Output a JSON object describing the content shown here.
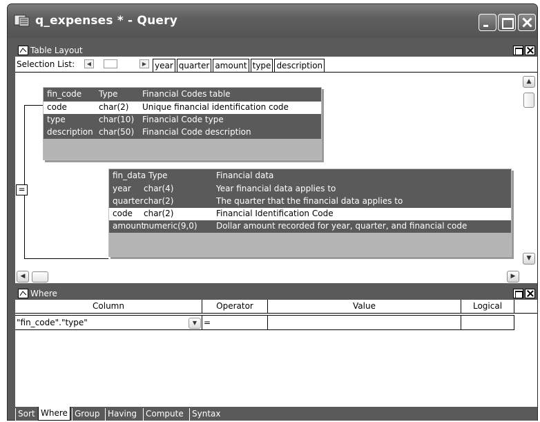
{
  "window": {
    "title": "q_expenses * - Query"
  },
  "table_layout": {
    "title": "Table Layout",
    "selection_label": "Selection List:",
    "selection_items": [
      "year",
      "quarter",
      "amount",
      "type",
      "description"
    ],
    "link_operator": "=",
    "fin_code": {
      "header": [
        "fin_code",
        "Type",
        "Financial Codes table"
      ],
      "rows": [
        [
          "code",
          "char(2)",
          "Unique financial identification code"
        ],
        [
          "type",
          "char(10)",
          "Financial Code type"
        ],
        [
          "description",
          "char(50)",
          "Financial Code description"
        ]
      ]
    },
    "fin_data": {
      "header": [
        "fin_data",
        "Type",
        "Financial data"
      ],
      "rows": [
        [
          "year",
          "char(4)",
          "Year financial data applies to"
        ],
        [
          "quarter",
          "char(2)",
          "The quarter that the financial data applies to"
        ],
        [
          "code",
          "char(2)",
          "Financial Identification Code"
        ],
        [
          "amount",
          "numeric(9,0)",
          "Dollar amount recorded for year, quarter, and financial code"
        ]
      ]
    }
  },
  "where": {
    "title": "Where",
    "columns": [
      "Column",
      "Operator",
      "Value",
      "Logical"
    ],
    "rows": [
      {
        "column": "\"fin_code\".\"type\"",
        "operator": "=",
        "value": "",
        "logical": ""
      }
    ]
  },
  "tabs": [
    "Sort",
    "Where",
    "Group",
    "Having",
    "Compute",
    "Syntax"
  ],
  "active_tab": "Where"
}
